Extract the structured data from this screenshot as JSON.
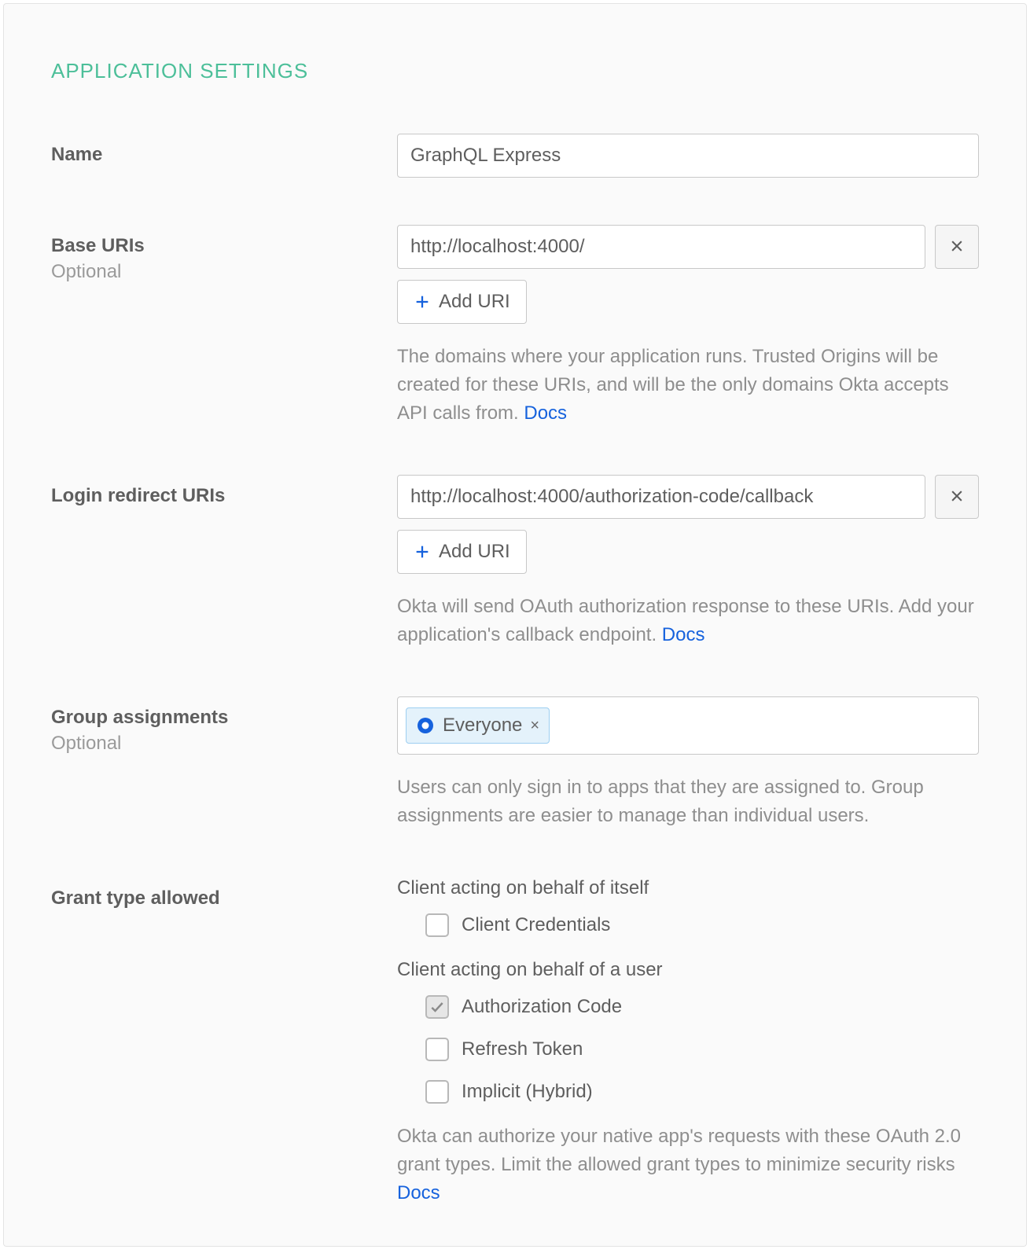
{
  "section_title": "APPLICATION SETTINGS",
  "name": {
    "label": "Name",
    "value": "GraphQL Express"
  },
  "base_uris": {
    "label": "Base URIs",
    "sublabel": "Optional",
    "value": "http://localhost:4000/",
    "add_label": "Add URI",
    "help_text": "The domains where your application runs. Trusted Origins will be created for these URIs, and will be the only domains Okta accepts API calls from. ",
    "docs_label": "Docs"
  },
  "login_redirect": {
    "label": "Login redirect URIs",
    "value": "http://localhost:4000/authorization-code/callback",
    "add_label": "Add URI",
    "help_text": "Okta will send OAuth authorization response to these URIs. Add your application's callback endpoint. ",
    "docs_label": "Docs"
  },
  "groups": {
    "label": "Group assignments",
    "sublabel": "Optional",
    "token": "Everyone",
    "help_text": "Users can only sign in to apps that they are assigned to. Group assignments are easier to manage than individual users."
  },
  "grant": {
    "label": "Grant type allowed",
    "self_heading": "Client acting on behalf of itself",
    "self_options": {
      "client_credentials": "Client Credentials"
    },
    "user_heading": "Client acting on behalf of a user",
    "user_options": {
      "authorization_code": "Authorization Code",
      "refresh_token": "Refresh Token",
      "implicit": "Implicit (Hybrid)"
    },
    "help_text": "Okta can authorize your native app's requests with these OAuth 2.0 grant types. Limit the allowed grant types to minimize security risks ",
    "docs_label": "Docs"
  }
}
